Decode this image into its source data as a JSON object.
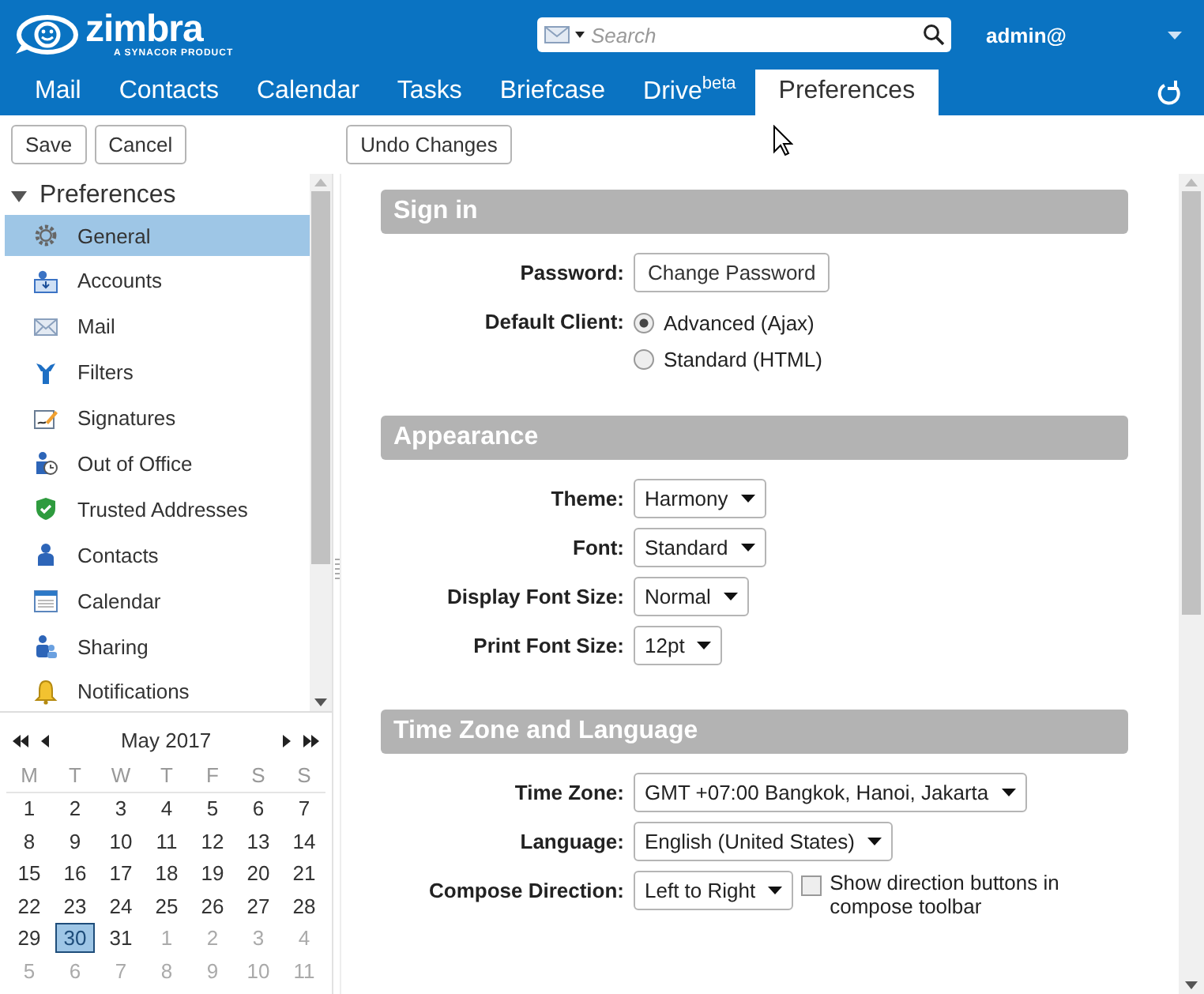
{
  "header": {
    "logo": "zimbra",
    "logo_tagline": "A SYNACOR PRODUCT",
    "search": {
      "placeholder": "Search"
    },
    "user": "admin@"
  },
  "tabs": [
    {
      "label": "Mail",
      "selected": false
    },
    {
      "label": "Contacts",
      "selected": false
    },
    {
      "label": "Calendar",
      "selected": false
    },
    {
      "label": "Tasks",
      "selected": false
    },
    {
      "label": "Briefcase",
      "selected": false
    },
    {
      "label": "Drive$^{beta}$",
      "selected": false
    },
    {
      "label": "Preferences",
      "selected": true
    }
  ],
  "toolbar": {
    "buttons": [
      "Save",
      "Cancel"
    ],
    "undo": "Undo Changes"
  },
  "sidebar": {
    "title": "Preferences",
    "expanded": true,
    "items": [
      {
        "label": "General",
        "selected": true
      },
      {
        "label": "Accounts",
        "selected": false
      },
      {
        "label": "Mail",
        "selected": false
      },
      {
        "label": "Filters",
        "selected": false
      },
      {
        "label": "Signatures",
        "selected": false
      },
      {
        "label": "Out of Office",
        "selected": false
      },
      {
        "label": "Trusted Addresses",
        "selected": false
      },
      {
        "label": "Contacts",
        "selected": false
      },
      {
        "label": "Calendar",
        "selected": false
      },
      {
        "label": "Sharing",
        "selected": false
      },
      {
        "label": "Notifications",
        "selected": false
      }
    ]
  },
  "mini_calendar": {
    "title": "May 2017",
    "weekdays": [
      "M",
      "T",
      "W",
      "T",
      "F",
      "S",
      "S"
    ],
    "weeks": [
      [
        {
          "day": "1",
          "other_month": false,
          "selected": false
        },
        {
          "day": "2",
          "other_month": false,
          "selected": false
        },
        {
          "day": "3",
          "other_month": false,
          "selected": false
        },
        {
          "day": "4",
          "other_month": false,
          "selected": false
        },
        {
          "day": "5",
          "other_month": false,
          "selected": false
        },
        {
          "day": "6",
          "other_month": false,
          "selected": false
        },
        {
          "day": "7",
          "other_month": false,
          "selected": false
        }
      ],
      [
        {
          "day": "8",
          "other_month": false,
          "selected": false
        },
        {
          "day": "9",
          "other_month": false,
          "selected": false
        },
        {
          "day": "10",
          "other_month": false,
          "selected": false
        },
        {
          "day": "11",
          "other_month": false,
          "selected": false
        },
        {
          "day": "12",
          "other_month": false,
          "selected": false
        },
        {
          "day": "13",
          "other_month": false,
          "selected": false
        },
        {
          "day": "14",
          "other_month": false,
          "selected": false
        }
      ],
      [
        {
          "day": "15",
          "other_month": false,
          "selected": false
        },
        {
          "day": "16",
          "other_month": false,
          "selected": false
        },
        {
          "day": "17",
          "other_month": false,
          "selected": false
        },
        {
          "day": "18",
          "other_month": false,
          "selected": false
        },
        {
          "day": "19",
          "other_month": false,
          "selected": false
        },
        {
          "day": "20",
          "other_month": false,
          "selected": false
        },
        {
          "day": "21",
          "other_month": false,
          "selected": false
        }
      ],
      [
        {
          "day": "22",
          "other_month": false,
          "selected": false
        },
        {
          "day": "23",
          "other_month": false,
          "selected": false
        },
        {
          "day": "24",
          "other_month": false,
          "selected": false
        },
        {
          "day": "25",
          "other_month": false,
          "selected": false
        },
        {
          "day": "26",
          "other_month": false,
          "selected": false
        },
        {
          "day": "27",
          "other_month": false,
          "selected": false
        },
        {
          "day": "28",
          "other_month": false,
          "selected": false
        }
      ],
      [
        {
          "day": "29",
          "other_month": false,
          "selected": false
        },
        {
          "day": "30",
          "other_month": false,
          "selected": true
        },
        {
          "day": "31",
          "other_month": false,
          "selected": false
        },
        {
          "day": "1",
          "other_month": true,
          "selected": false
        },
        {
          "day": "2",
          "other_month": true,
          "selected": false
        },
        {
          "day": "3",
          "other_month": true,
          "selected": false
        },
        {
          "day": "4",
          "other_month": true,
          "selected": false
        }
      ],
      [
        {
          "day": "5",
          "other_month": true,
          "selected": false
        },
        {
          "day": "6",
          "other_month": true,
          "selected": false
        },
        {
          "day": "7",
          "other_month": true,
          "selected": false
        },
        {
          "day": "8",
          "other_month": true,
          "selected": false
        },
        {
          "day": "9",
          "other_month": true,
          "selected": false
        },
        {
          "day": "10",
          "other_month": true,
          "selected": false
        },
        {
          "day": "11",
          "other_month": true,
          "selected": false
        }
      ]
    ]
  },
  "sections": [
    {
      "title": "Sign in",
      "rows": [
        {
          "kind": "button",
          "label": "Password:",
          "value": "Change Password"
        },
        {
          "kind": "radio",
          "label": "Default Client:",
          "options": [
            {
              "label": "Advanced (Ajax)",
              "selected": true
            },
            {
              "label": "Standard (HTML)",
              "selected": false
            }
          ]
        }
      ]
    },
    {
      "title": "Appearance",
      "rows": [
        {
          "kind": "select",
          "label": "Theme:",
          "value": "Harmony"
        },
        {
          "kind": "select",
          "label": "Font:",
          "value": "Standard"
        },
        {
          "kind": "select",
          "label": "Display Font Size:",
          "value": "Normal"
        },
        {
          "kind": "select",
          "label": "Print Font Size:",
          "value": "12pt"
        }
      ]
    },
    {
      "title": "Time Zone and Language",
      "rows": [
        {
          "kind": "select",
          "label": "Time Zone:",
          "value": "GMT +07:00 Bangkok, Hanoi, Jakarta"
        },
        {
          "kind": "select",
          "label": "Language:",
          "value": "English (United States)"
        },
        {
          "kind": "select",
          "label": "Compose Direction:",
          "value": "Left to Right",
          "checkbox": {
            "label": "Show direction buttons in compose toolbar",
            "checked": false
          }
        }
      ]
    }
  ]
}
